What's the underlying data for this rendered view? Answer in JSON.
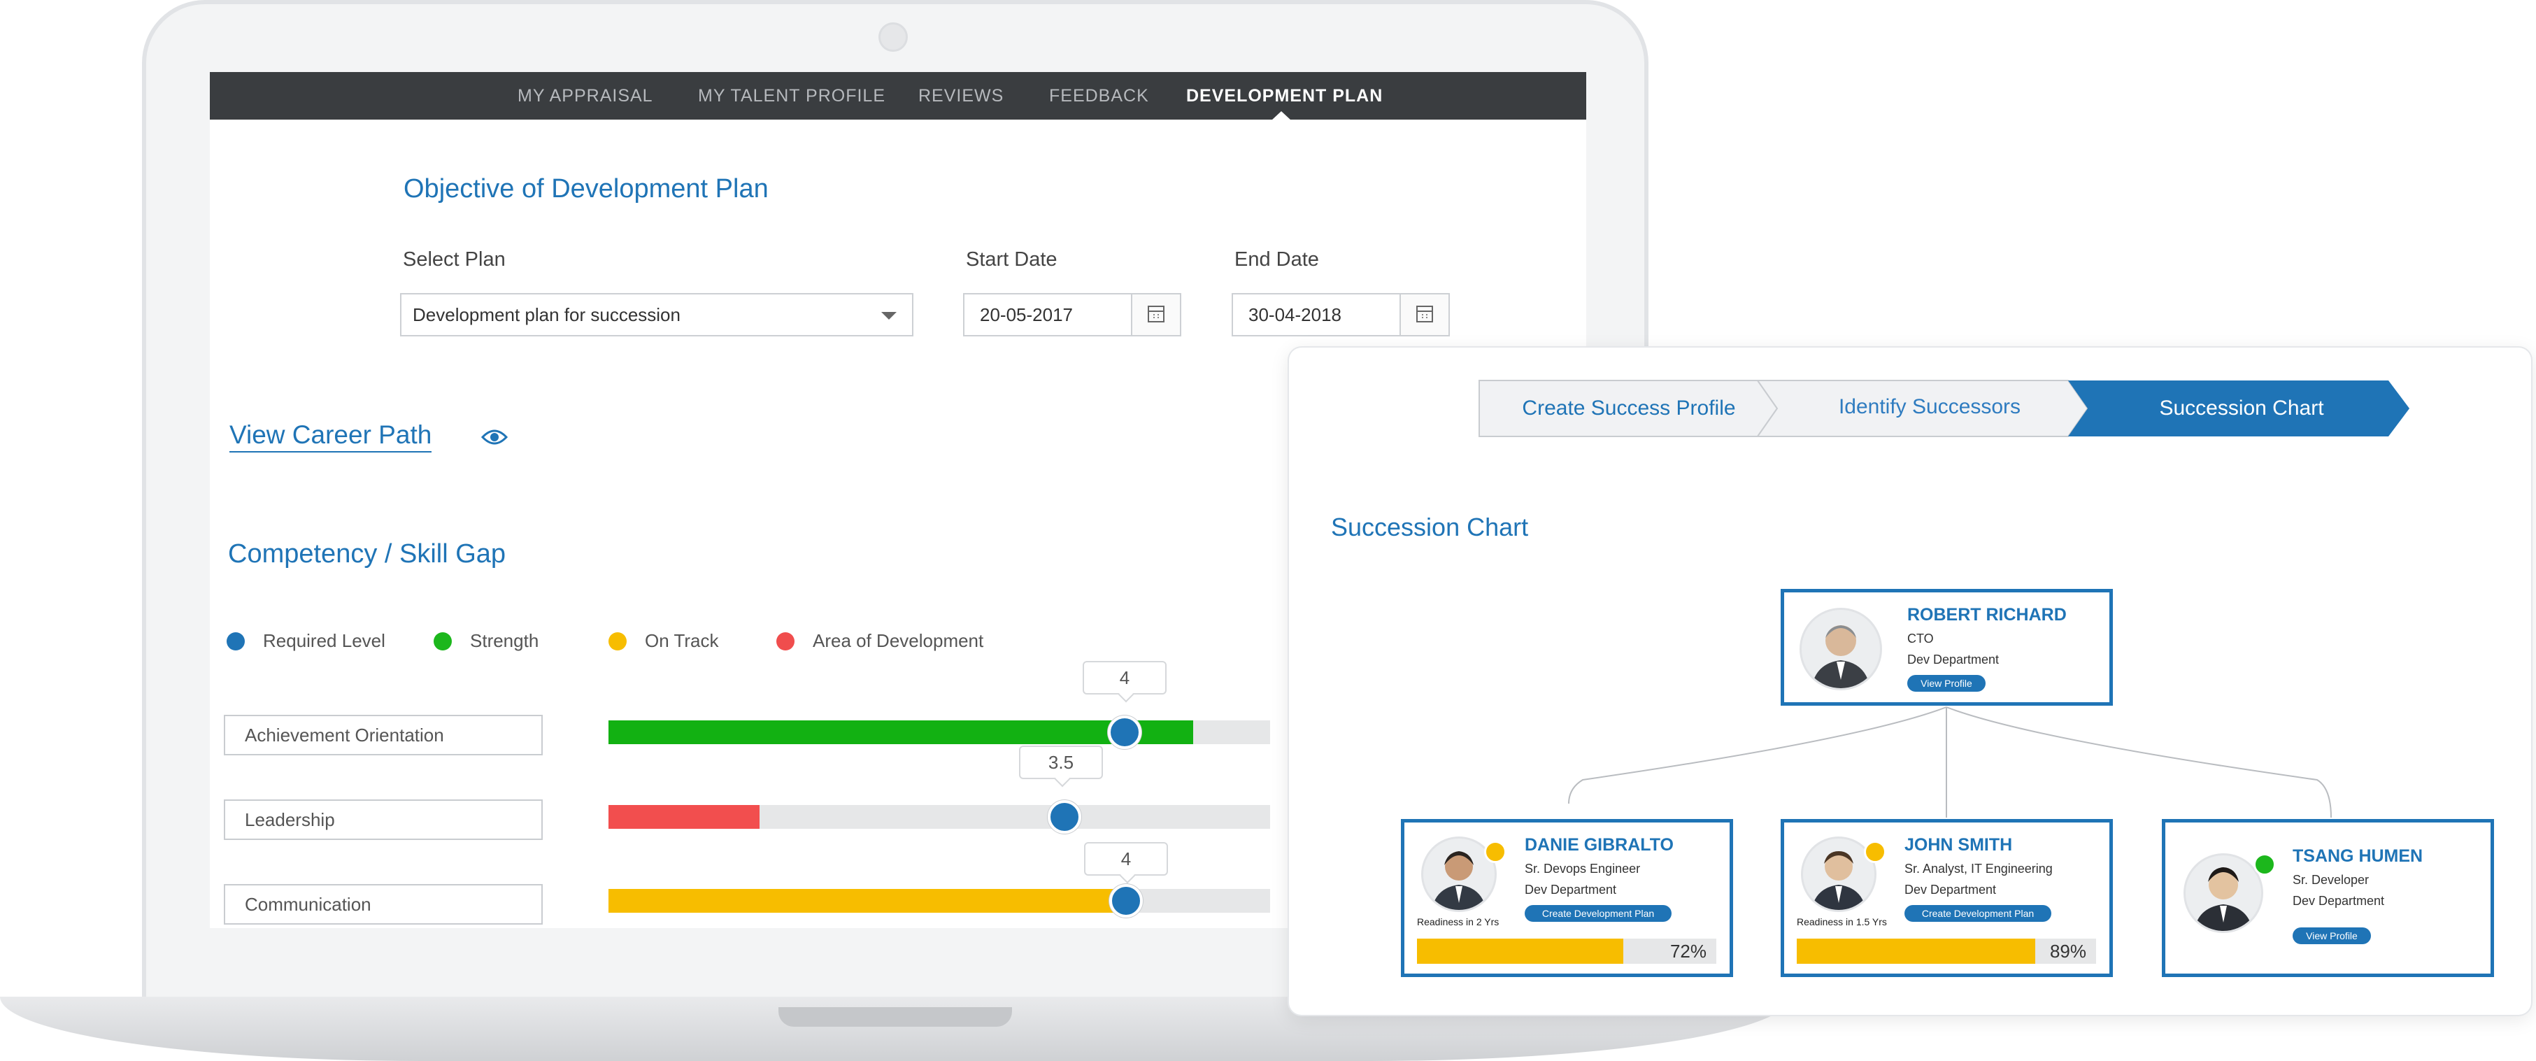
{
  "nav": {
    "items": [
      "MY APPRAISAL",
      "MY TALENT PROFILE",
      "REVIEWS",
      "FEEDBACK",
      "DEVELOPMENT PLAN"
    ],
    "active": "DEVELOPMENT PLAN"
  },
  "plan": {
    "heading": "Objective of Development Plan",
    "select_label": "Select Plan",
    "select_value": "Development plan for succession",
    "start_label": "Start Date",
    "start_value": "20-05-2017",
    "end_label": "End Date",
    "end_value": "30-04-2018"
  },
  "career": {
    "link": "View Career Path"
  },
  "competency": {
    "heading": "Competency / Skill Gap",
    "legend": [
      {
        "label": "Required Level",
        "color": "#1f74b6"
      },
      {
        "label": "Strength",
        "color": "#1cb71c"
      },
      {
        "label": "On Track",
        "color": "#f7bd00"
      },
      {
        "label": "Area of Development",
        "color": "#f04d4d"
      }
    ],
    "skills": [
      {
        "name": "Achievement Orientation",
        "required": "4",
        "status_color": "#12b112"
      },
      {
        "name": "Leadership",
        "required": "3.5",
        "status_color": "#f24e4e"
      },
      {
        "name": "Communication",
        "required": "4",
        "status_color": "#f7bd00"
      }
    ]
  },
  "succession": {
    "steps": [
      "Create Success Profile",
      "Identify Successors",
      "Succession Chart"
    ],
    "active_step": "Succession Chart",
    "title": "Succession Chart",
    "root": {
      "name": "ROBERT RICHARD",
      "role": "CTO",
      "department": "Dev Department",
      "button": "View Profile"
    },
    "children": [
      {
        "name": "DANIE GIBRALTO",
        "role": "Sr. Devops Engineer",
        "department": "Dev Department",
        "button": "Create Development Plan",
        "readiness": "Readiness in 2 Yrs",
        "progress": "72%",
        "status_color": "#f7bd00"
      },
      {
        "name": "JOHN SMITH",
        "role": "Sr. Analyst, IT Engineering",
        "department": "Dev Department",
        "button": "Create Development Plan",
        "readiness": "Readiness in 1.5 Yrs",
        "progress": "89%",
        "status_color": "#f7bd00"
      },
      {
        "name": "TSANG HUMEN",
        "role": "Sr. Developer",
        "department": "Dev Department",
        "button": "View Profile",
        "status_color": "#1cb71c"
      }
    ]
  }
}
